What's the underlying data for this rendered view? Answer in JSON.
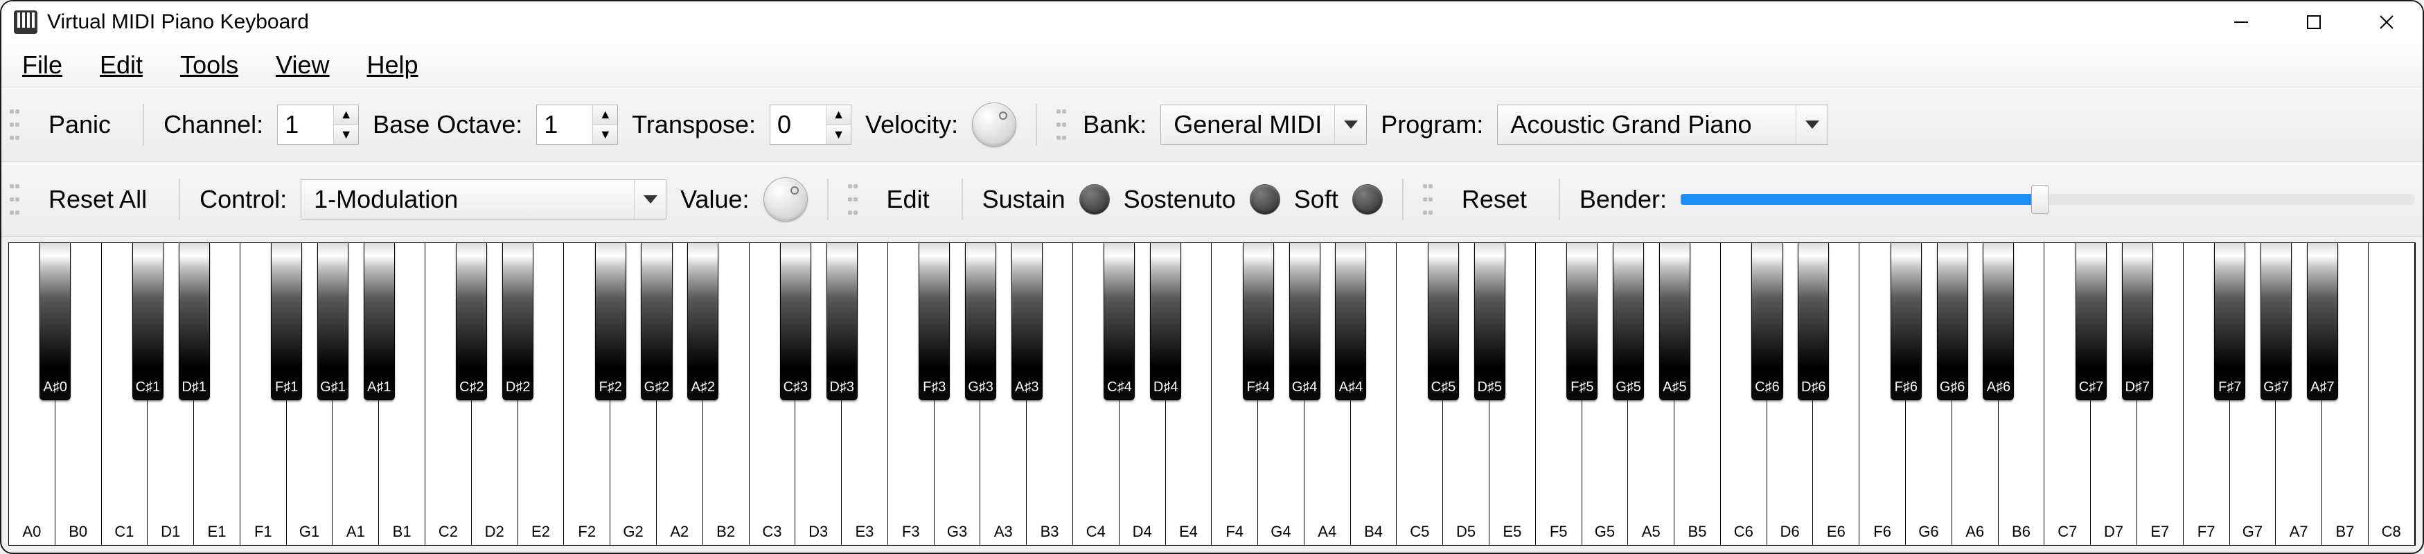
{
  "window": {
    "title": "Virtual MIDI Piano Keyboard"
  },
  "menu": {
    "file": "File",
    "edit": "Edit",
    "tools": "Tools",
    "view": "View",
    "help": "Help"
  },
  "toolbar1": {
    "panic": "Panic",
    "channel_label": "Channel:",
    "channel_value": "1",
    "base_octave_label": "Base Octave:",
    "base_octave_value": "1",
    "transpose_label": "Transpose:",
    "transpose_value": "0",
    "velocity_label": "Velocity:",
    "bank_label": "Bank:",
    "bank_value": "General MIDI",
    "program_label": "Program:",
    "program_value": "Acoustic Grand Piano"
  },
  "toolbar2": {
    "reset_all": "Reset All",
    "control_label": "Control:",
    "control_value": "1-Modulation",
    "value_label": "Value:",
    "edit": "Edit",
    "sustain": "Sustain",
    "sostenuto": "Sostenuto",
    "soft": "Soft",
    "reset": "Reset",
    "bender_label": "Bender:",
    "bender_value": 50
  },
  "piano": {
    "white_notes": [
      "A0",
      "B0",
      "C1",
      "D1",
      "E1",
      "F1",
      "G1",
      "A1",
      "B1",
      "C2",
      "D2",
      "E2",
      "F2",
      "G2",
      "A2",
      "B2",
      "C3",
      "D3",
      "E3",
      "F3",
      "G3",
      "A3",
      "B3",
      "C4",
      "D4",
      "E4",
      "F4",
      "G4",
      "A4",
      "B4",
      "C5",
      "D5",
      "E5",
      "F5",
      "G5",
      "A5",
      "B5",
      "C6",
      "D6",
      "E6",
      "F6",
      "G6",
      "A6",
      "B6",
      "C7",
      "D7",
      "E7",
      "F7",
      "G7",
      "A7",
      "B7",
      "C8"
    ],
    "black_notes": [
      {
        "label": "A♯0",
        "after": "A0"
      },
      {
        "label": "C♯1",
        "after": "C1"
      },
      {
        "label": "D♯1",
        "after": "D1"
      },
      {
        "label": "F♯1",
        "after": "F1"
      },
      {
        "label": "G♯1",
        "after": "G1"
      },
      {
        "label": "A♯1",
        "after": "A1"
      },
      {
        "label": "C♯2",
        "after": "C2"
      },
      {
        "label": "D♯2",
        "after": "D2"
      },
      {
        "label": "F♯2",
        "after": "F2"
      },
      {
        "label": "G♯2",
        "after": "G2"
      },
      {
        "label": "A♯2",
        "after": "A2"
      },
      {
        "label": "C♯3",
        "after": "C3"
      },
      {
        "label": "D♯3",
        "after": "D3"
      },
      {
        "label": "F♯3",
        "after": "F3"
      },
      {
        "label": "G♯3",
        "after": "G3"
      },
      {
        "label": "A♯3",
        "after": "A3"
      },
      {
        "label": "C♯4",
        "after": "C4"
      },
      {
        "label": "D♯4",
        "after": "D4"
      },
      {
        "label": "F♯4",
        "after": "F4"
      },
      {
        "label": "G♯4",
        "after": "G4"
      },
      {
        "label": "A♯4",
        "after": "A4"
      },
      {
        "label": "C♯5",
        "after": "C5"
      },
      {
        "label": "D♯5",
        "after": "D5"
      },
      {
        "label": "F♯5",
        "after": "F5"
      },
      {
        "label": "G♯5",
        "after": "G5"
      },
      {
        "label": "A♯5",
        "after": "A5"
      },
      {
        "label": "C♯6",
        "after": "C6"
      },
      {
        "label": "D♯6",
        "after": "D6"
      },
      {
        "label": "F♯6",
        "after": "F6"
      },
      {
        "label": "G♯6",
        "after": "G6"
      },
      {
        "label": "A♯6",
        "after": "A6"
      },
      {
        "label": "C♯7",
        "after": "C7"
      },
      {
        "label": "D♯7",
        "after": "D7"
      },
      {
        "label": "F♯7",
        "after": "F7"
      },
      {
        "label": "G♯7",
        "after": "G7"
      },
      {
        "label": "A♯7",
        "after": "A7"
      }
    ]
  }
}
